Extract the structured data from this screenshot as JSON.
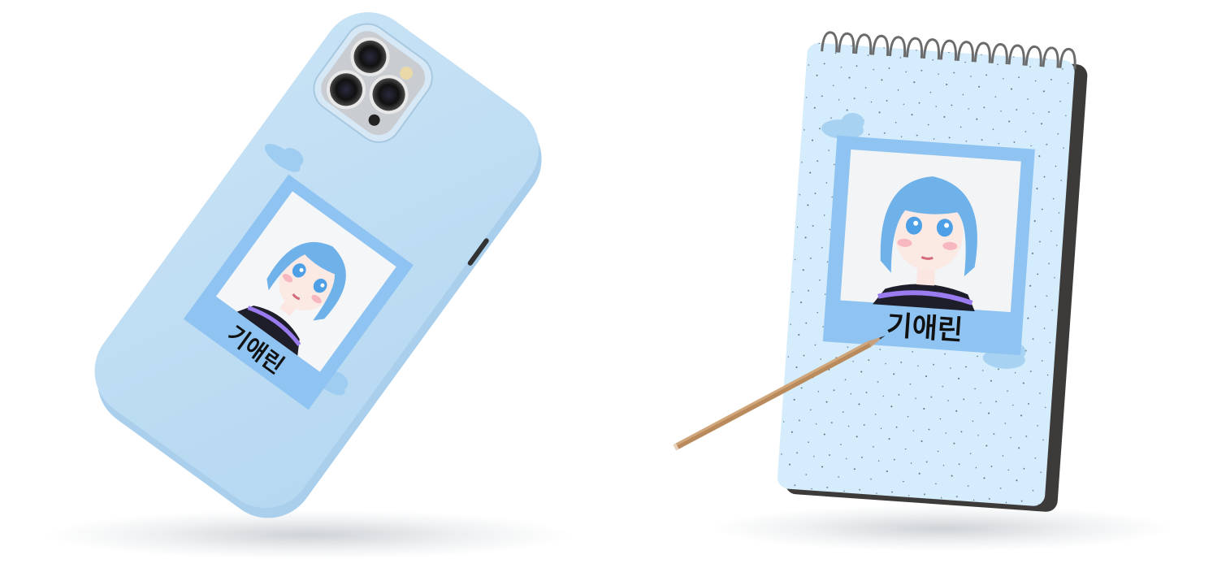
{
  "phone_case": {
    "name_text": "기애린",
    "case_color": "#bfdcf2",
    "frame_color": "#8fc4f2"
  },
  "notepad": {
    "name_text": "기애린",
    "paper_color": "#d4ecfb",
    "frame_color": "#8fc4f2"
  },
  "character": {
    "hair_color": "#6fb2ea",
    "shirt_color": "#1e1e2a",
    "stripe_color": "#9a7cf0"
  },
  "icons": [
    "phone-case",
    "notepad",
    "pencil",
    "cloud"
  ]
}
